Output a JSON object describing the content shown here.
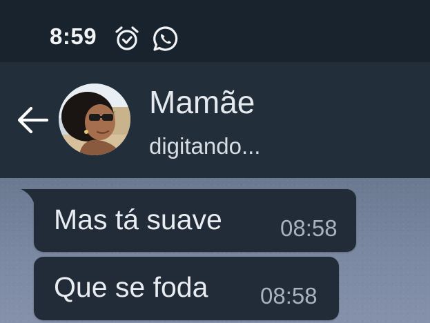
{
  "status_bar": {
    "time": "8:59",
    "icons": [
      "alarm-clock-icon",
      "whatsapp-icon"
    ]
  },
  "header": {
    "back_icon": "arrow-back-icon",
    "contact_name": "Mamãe",
    "contact_status": "digitando..."
  },
  "messages": [
    {
      "text": "Mas tá suave",
      "time": "08:58"
    },
    {
      "text": "Que se foda",
      "time": "08:58"
    }
  ],
  "colors": {
    "status_bar_bg": "#18232d",
    "header_bg": "#222f3b",
    "bubble_bg": "#222c38",
    "chat_bg": "#7c89a3"
  }
}
